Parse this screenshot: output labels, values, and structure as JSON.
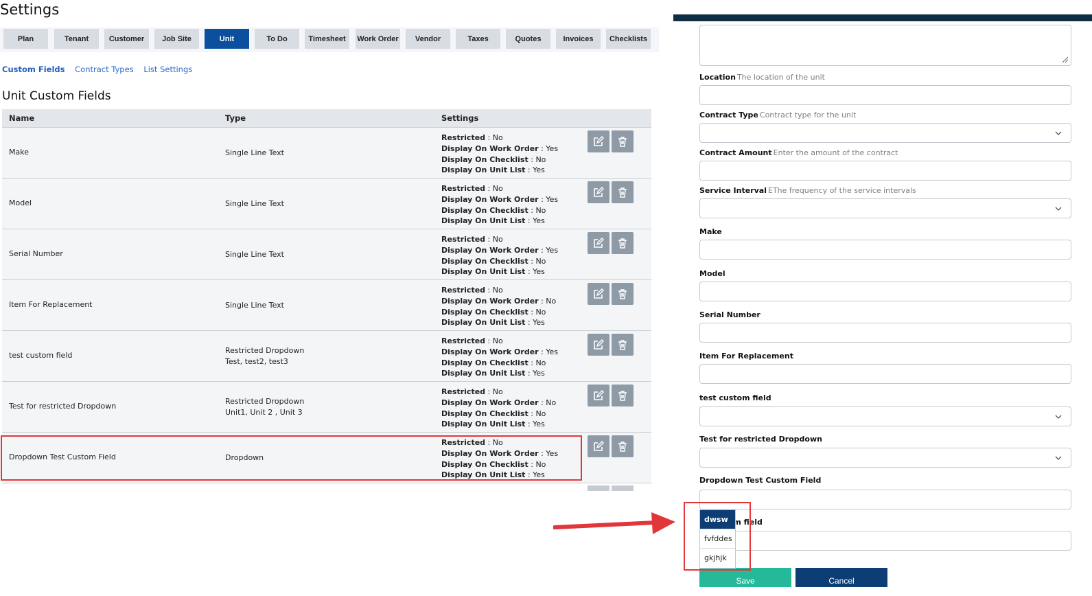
{
  "page_title": "Settings",
  "tabs": [
    {
      "label": "Plan"
    },
    {
      "label": "Tenant"
    },
    {
      "label": "Customer"
    },
    {
      "label": "Job Site"
    },
    {
      "label": "Unit",
      "active": true
    },
    {
      "label": "To Do"
    },
    {
      "label": "Timesheet"
    },
    {
      "label": "Work Order"
    },
    {
      "label": "Vendor"
    },
    {
      "label": "Taxes"
    },
    {
      "label": "Quotes"
    },
    {
      "label": "Invoices"
    },
    {
      "label": "Checklists"
    }
  ],
  "subtabs": [
    {
      "label": "Custom Fields",
      "active": true
    },
    {
      "label": "Contract Types"
    },
    {
      "label": "List Settings"
    }
  ],
  "section_title": "Unit Custom Fields",
  "table": {
    "headers": {
      "name": "Name",
      "type": "Type",
      "settings": "Settings"
    },
    "setting_labels": {
      "restricted": "Restricted",
      "work_order": "Display On Work Order",
      "checklist": "Display On Checklist",
      "unit_list": "Display On Unit List"
    },
    "rows": [
      {
        "name": "Make",
        "type": "Single Line Text",
        "options": "",
        "restricted": "No",
        "work_order": "Yes",
        "checklist": "No",
        "unit_list": "Yes"
      },
      {
        "name": "Model",
        "type": "Single Line Text",
        "options": "",
        "restricted": "No",
        "work_order": "Yes",
        "checklist": "No",
        "unit_list": "Yes"
      },
      {
        "name": "Serial Number",
        "type": "Single Line Text",
        "options": "",
        "restricted": "No",
        "work_order": "Yes",
        "checklist": "No",
        "unit_list": "Yes"
      },
      {
        "name": "Item For Replacement",
        "type": "Single Line Text",
        "options": "",
        "restricted": "No",
        "work_order": "No",
        "checklist": "No",
        "unit_list": "Yes"
      },
      {
        "name": "test custom field",
        "type": "Restricted Dropdown",
        "options": "Test, test2, test3",
        "restricted": "No",
        "work_order": "Yes",
        "checklist": "No",
        "unit_list": "Yes"
      },
      {
        "name": "Test for restricted Dropdown",
        "type": "Restricted Dropdown",
        "options": "Unit1, Unit 2 , Unit 3",
        "restricted": "No",
        "work_order": "No",
        "checklist": "No",
        "unit_list": "Yes"
      },
      {
        "name": "Dropdown Test Custom Field",
        "type": "Dropdown",
        "options": "",
        "restricted": "No",
        "work_order": "Yes",
        "checklist": "No",
        "unit_list": "Yes"
      }
    ]
  },
  "form": {
    "fields": [
      {
        "label": "Location",
        "hint": "The location of the unit",
        "kind": "input"
      },
      {
        "label": "Contract Type",
        "hint": "Contract type for the unit",
        "kind": "select"
      },
      {
        "label": "Contract Amount",
        "hint": "Enter the amount of the contract",
        "kind": "input"
      },
      {
        "label": "Service Interval",
        "hint": "EThe frequency of the service intervals",
        "kind": "select"
      },
      {
        "label": "Make",
        "hint": "",
        "kind": "input"
      },
      {
        "label": "Model",
        "hint": "",
        "kind": "input"
      },
      {
        "label": "Serial Number",
        "hint": "",
        "kind": "input"
      },
      {
        "label": "Item For Replacement",
        "hint": "",
        "kind": "input"
      },
      {
        "label": "test custom field",
        "hint": "",
        "kind": "select"
      },
      {
        "label": "Test for restricted Dropdown",
        "hint": "",
        "kind": "select"
      },
      {
        "label": "Dropdown Test Custom Field",
        "hint": "",
        "kind": "input"
      },
      {
        "label": "ct custom field",
        "hint": "",
        "kind": "input"
      }
    ],
    "dropdown_options": [
      {
        "label": "dwsw",
        "selected": true
      },
      {
        "label": "fvfddes"
      },
      {
        "label": "gkjhjk"
      }
    ],
    "save_label": "Save",
    "cancel_label": "Cancel"
  },
  "colors": {
    "primary": "#0c4f9e",
    "dark_navy": "#0c3d75",
    "save_green": "#25b99a",
    "highlight_red": "#e2373a"
  }
}
